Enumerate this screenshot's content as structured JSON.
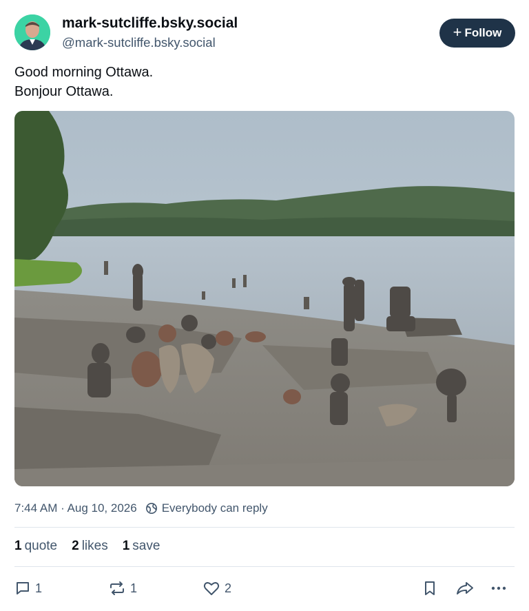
{
  "author": {
    "display_name": "mark-sutcliffe.bsky.social",
    "handle": "@mark-sutcliffe.bsky.social",
    "follow_label": "Follow"
  },
  "post": {
    "lines": [
      "Good morning Ottawa.",
      "Bonjour Ottawa."
    ],
    "timestamp": "7:44 AM · Aug 10, 2026",
    "reply_setting": "Everybody can reply"
  },
  "stats": {
    "quotes": {
      "count": "1",
      "label": "quote"
    },
    "likes": {
      "count": "2",
      "label": "likes"
    },
    "saves": {
      "count": "1",
      "label": "save"
    }
  },
  "actions": {
    "reply_count": "1",
    "repost_count": "1",
    "like_count": "2"
  },
  "icons": [
    "avatar",
    "plus-icon",
    "globe-icon",
    "reply-icon",
    "repost-icon",
    "like-icon",
    "bookmark-icon",
    "share-icon",
    "more-icon"
  ],
  "colors": {
    "follow_bg": "#1f3348",
    "muted_text": "#42566c",
    "divider": "#dfe5ec"
  }
}
